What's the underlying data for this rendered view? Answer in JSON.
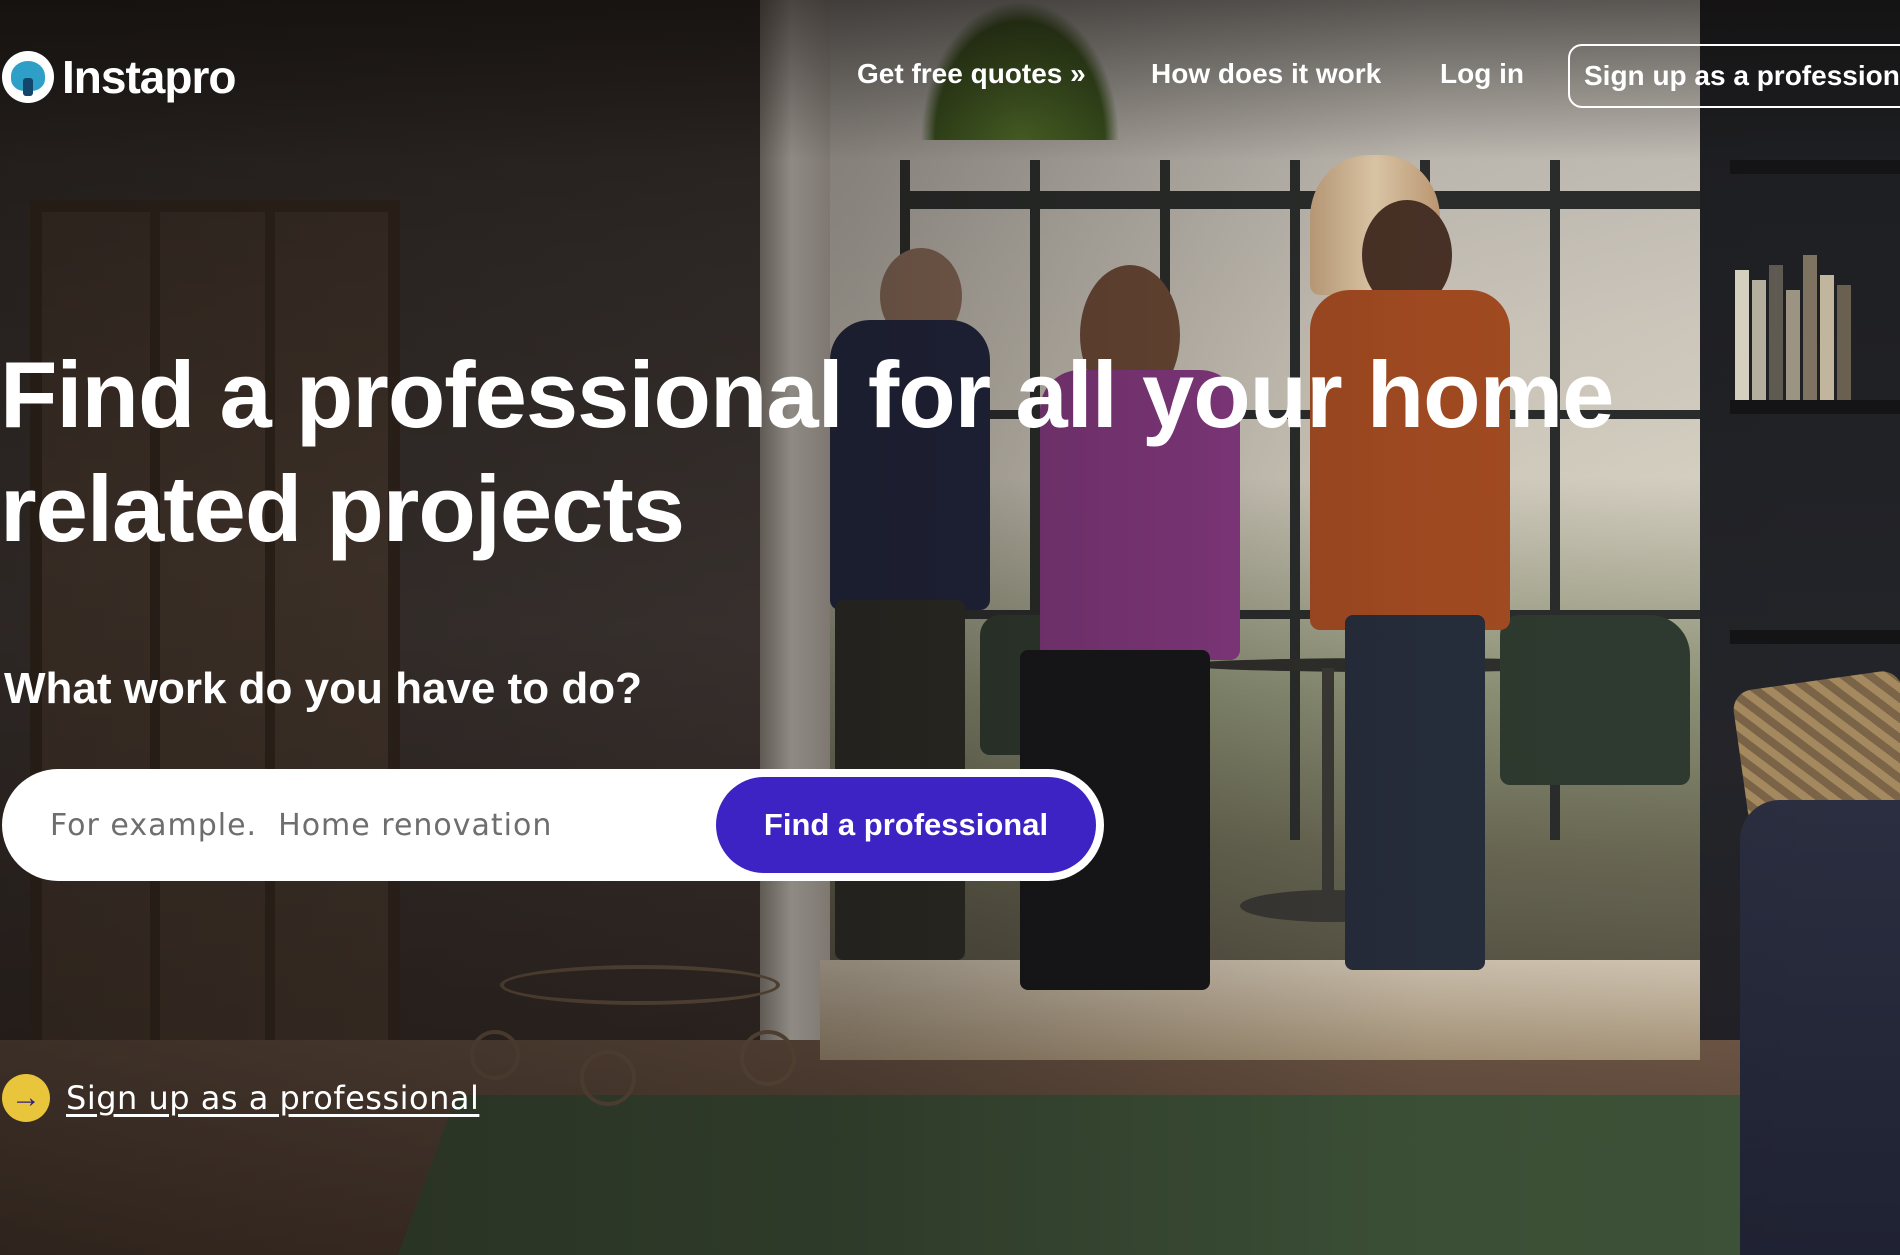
{
  "brand": {
    "name": "Instapro",
    "logo_icon": "instapro-logo-icon"
  },
  "nav": {
    "get_quotes": "Get free quotes »",
    "how_it_works": "How does it work",
    "login": "Log in",
    "signup_professional": "Sign up as a professional"
  },
  "hero": {
    "headline_line1": "Find a professional for all your home",
    "headline_line2": "related projects",
    "question": "What work do you have to do?",
    "search_placeholder": "For example.  Home renovation",
    "search_value": "",
    "find_button": "Find a professional",
    "signup_link": "Sign up as a professional",
    "signup_icon": "arrow-right-icon"
  },
  "colors": {
    "primary_button": "#3d23c4",
    "arrow_circle": "#e8c53a",
    "text": "#ffffff"
  }
}
